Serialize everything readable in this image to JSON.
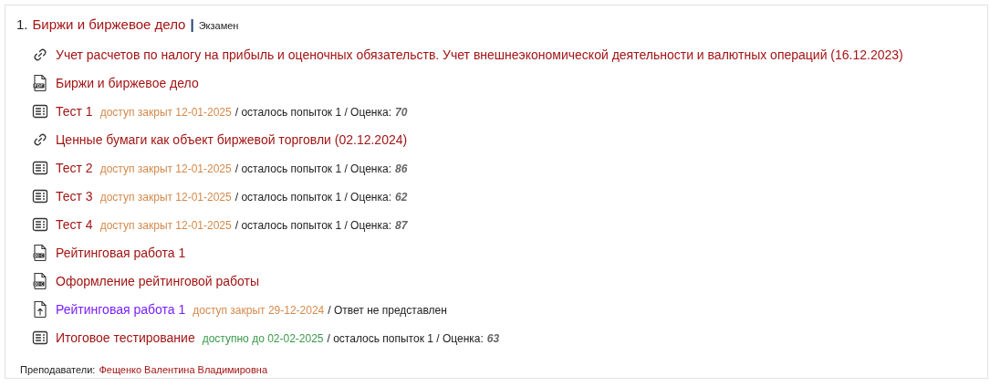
{
  "course": {
    "number": "1.",
    "title": "Биржи и биржевое дело",
    "separator": "|",
    "exam_type": "Экзамен",
    "items": [
      {
        "kind": "link",
        "title": "Учет расчетов по налогу на прибыль и оценочных обязательств. Учет внешнеэкономической деятельности и валютных операций (16.12.2023)",
        "visited": false
      },
      {
        "kind": "pdf",
        "title": "Биржи и биржевое дело",
        "visited": false
      },
      {
        "kind": "test",
        "title": "Тест 1",
        "visited": false,
        "status": "доступ закрыт 12-01-2025",
        "open": false,
        "details": "/ осталось попыток 1 / Оценка:",
        "grade": "70"
      },
      {
        "kind": "link",
        "title": "Ценные бумаги как объект биржевой торговли (02.12.2024)",
        "visited": false
      },
      {
        "kind": "test",
        "title": "Тест 2",
        "visited": false,
        "status": "доступ закрыт 12-01-2025",
        "open": false,
        "details": "/ осталось попыток 1 / Оценка:",
        "grade": "86"
      },
      {
        "kind": "test",
        "title": "Тест 3",
        "visited": false,
        "status": "доступ закрыт 12-01-2025",
        "open": false,
        "details": "/ осталось попыток 1 / Оценка:",
        "grade": "62"
      },
      {
        "kind": "test",
        "title": "Тест 4",
        "visited": false,
        "status": "доступ закрыт 12-01-2025",
        "open": false,
        "details": "/ осталось попыток 1 / Оценка:",
        "grade": "87"
      },
      {
        "kind": "doc",
        "title": "Рейтинговая работа 1",
        "visited": false
      },
      {
        "kind": "doc",
        "title": "Оформление рейтинговой работы",
        "visited": false
      },
      {
        "kind": "upload",
        "title": "Рейтинговая работа 1",
        "visited": true,
        "status": "доступ закрыт 29-12-2024",
        "open": false,
        "details": "/ Ответ не представлен"
      },
      {
        "kind": "test",
        "title": "Итоговое тестирование",
        "visited": false,
        "status": "доступно до 02-02-2025",
        "open": true,
        "details": "/ осталось попыток 1 / Оценка:",
        "grade": "63"
      }
    ],
    "teachers_label": "Преподаватели:",
    "teachers": "Фещенко Валентина Владимировна"
  }
}
